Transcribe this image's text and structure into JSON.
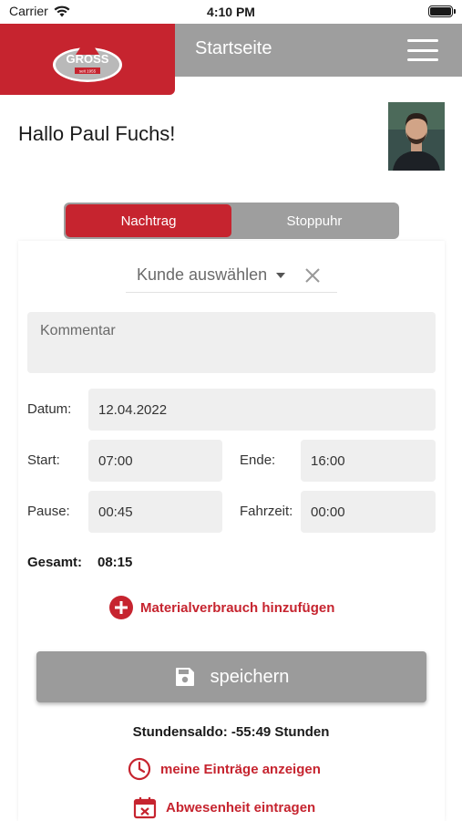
{
  "status_bar": {
    "carrier": "Carrier",
    "time": "4:10 PM"
  },
  "header": {
    "title": "Startseite",
    "logo_text": "GROSS",
    "logo_subtext": "seit 1955"
  },
  "greeting": "Hallo Paul Fuchs!",
  "tabs": [
    {
      "label": "Nachtrag",
      "active": true
    },
    {
      "label": "Stoppuhr",
      "active": false
    }
  ],
  "form": {
    "kunde_placeholder": "Kunde auswählen",
    "kommentar_placeholder": "Kommentar",
    "datum_label": "Datum:",
    "datum_value": "12.04.2022",
    "start_label": "Start:",
    "start_value": "07:00",
    "ende_label": "Ende:",
    "ende_value": "16:00",
    "pause_label": "Pause:",
    "pause_value": "00:45",
    "fahrzeit_label": "Fahrzeit:",
    "fahrzeit_value": "00:00",
    "gesamt_label": "Gesamt:",
    "gesamt_value": "08:15"
  },
  "material_label": "Materialverbrauch hinzufügen",
  "save_label": "speichern",
  "saldo": "Stundensaldo: -55:49 Stunden",
  "links": {
    "entries": "meine Einträge anzeigen",
    "absence": "Abwesenheit eintragen"
  },
  "colors": {
    "brand_red": "#c6242f",
    "header_gray": "#9e9e9e"
  }
}
